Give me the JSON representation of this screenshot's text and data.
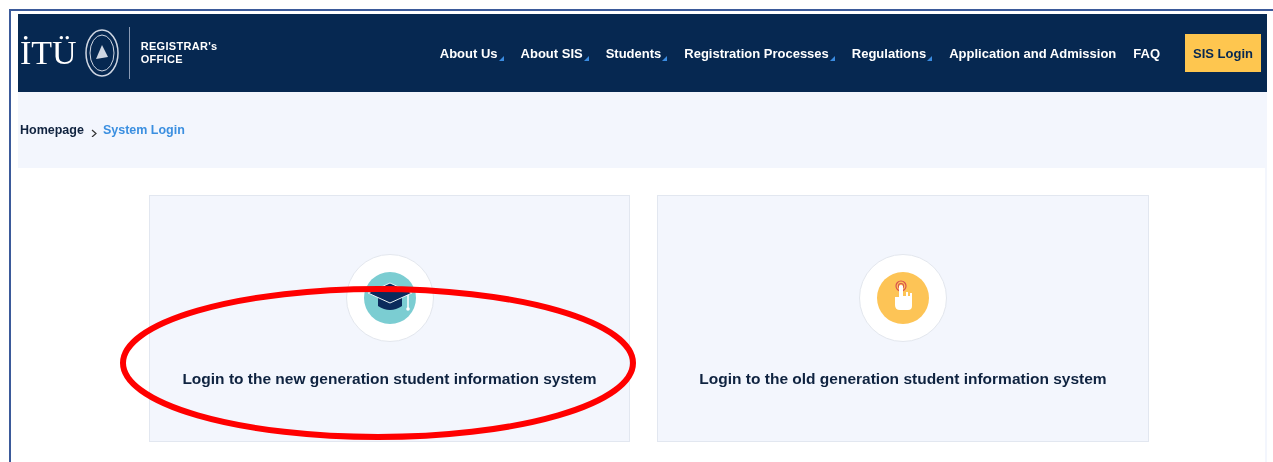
{
  "header": {
    "logo_text": "İTÜ",
    "office_title": [
      "REGISTRAR's",
      "OFFICE"
    ],
    "nav": [
      {
        "label": "About Us",
        "dropdown": true
      },
      {
        "label": "About SIS",
        "dropdown": true
      },
      {
        "label": "Students",
        "dropdown": true
      },
      {
        "label": "Registration Processes",
        "dropdown": true
      },
      {
        "label": "Regulations",
        "dropdown": true
      },
      {
        "label": "Application and Admission",
        "dropdown": false
      },
      {
        "label": "FAQ",
        "dropdown": false
      }
    ],
    "login_button": "SIS Login"
  },
  "breadcrumb": [
    {
      "label": "Homepage",
      "current": false
    },
    {
      "label": "System Login",
      "current": true
    }
  ],
  "cards": [
    {
      "kind": "graduation",
      "label": "Login to the new generation student information system",
      "circled": true
    },
    {
      "kind": "touch",
      "label": "Login to the old generation student information system",
      "circled": false
    }
  ]
}
